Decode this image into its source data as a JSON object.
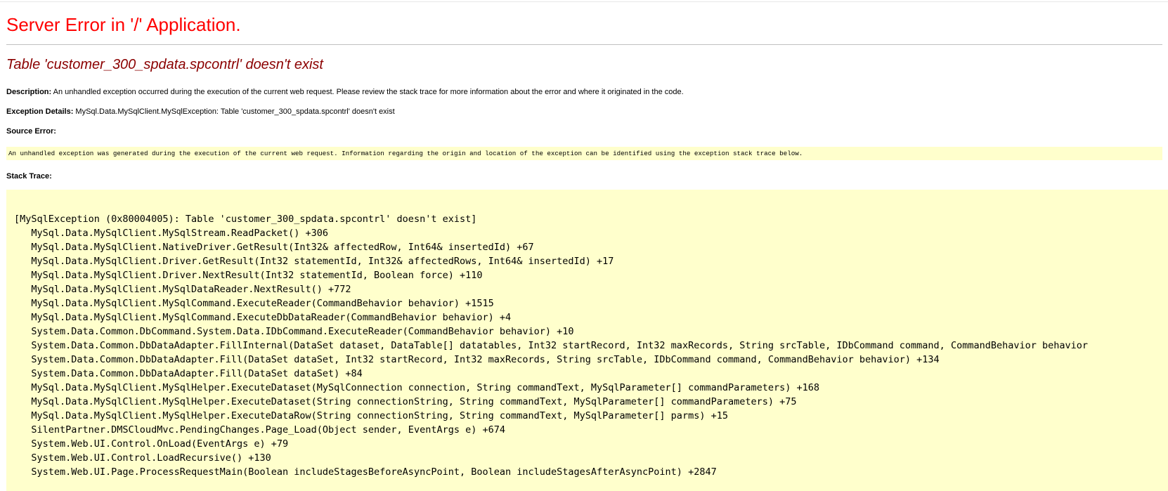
{
  "app_title": "Server Error in '/' Application.",
  "error_heading": "Table 'customer_300_spdata.spcontrl' doesn't exist",
  "description": {
    "label": "Description:",
    "text": " An unhandled exception occurred during the execution of the current web request. Please review the stack trace for more information about the error and where it originated in the code."
  },
  "exception_details": {
    "label": "Exception Details:",
    "text": " MySql.Data.MySqlClient.MySqlException: Table 'customer_300_spdata.spcontrl' doesn't exist"
  },
  "source_error": {
    "label": "Source Error:",
    "text": "An unhandled exception was generated during the execution of the current web request. Information regarding the origin and location of the exception can be identified using the exception stack trace below."
  },
  "stack_trace": {
    "label": "Stack Trace:",
    "lines": [
      "[MySqlException (0x80004005): Table 'customer_300_spdata.spcontrl' doesn't exist]",
      "   MySql.Data.MySqlClient.MySqlStream.ReadPacket() +306",
      "   MySql.Data.MySqlClient.NativeDriver.GetResult(Int32& affectedRow, Int64& insertedId) +67",
      "   MySql.Data.MySqlClient.Driver.GetResult(Int32 statementId, Int32& affectedRows, Int64& insertedId) +17",
      "   MySql.Data.MySqlClient.Driver.NextResult(Int32 statementId, Boolean force) +110",
      "   MySql.Data.MySqlClient.MySqlDataReader.NextResult() +772",
      "   MySql.Data.MySqlClient.MySqlCommand.ExecuteReader(CommandBehavior behavior) +1515",
      "   MySql.Data.MySqlClient.MySqlCommand.ExecuteDbDataReader(CommandBehavior behavior) +4",
      "   System.Data.Common.DbCommand.System.Data.IDbCommand.ExecuteReader(CommandBehavior behavior) +10",
      "   System.Data.Common.DbDataAdapter.FillInternal(DataSet dataset, DataTable[] datatables, Int32 startRecord, Int32 maxRecords, String srcTable, IDbCommand command, CommandBehavior behavior",
      "   System.Data.Common.DbDataAdapter.Fill(DataSet dataSet, Int32 startRecord, Int32 maxRecords, String srcTable, IDbCommand command, CommandBehavior behavior) +134",
      "   System.Data.Common.DbDataAdapter.Fill(DataSet dataSet) +84",
      "   MySql.Data.MySqlClient.MySqlHelper.ExecuteDataset(MySqlConnection connection, String commandText, MySqlParameter[] commandParameters) +168",
      "   MySql.Data.MySqlClient.MySqlHelper.ExecuteDataset(String connectionString, String commandText, MySqlParameter[] commandParameters) +75",
      "   MySql.Data.MySqlClient.MySqlHelper.ExecuteDataRow(String connectionString, String commandText, MySqlParameter[] parms) +15",
      "   SilentPartner.DMSCloudMvc.PendingChanges.Page_Load(Object sender, EventArgs e) +674",
      "   System.Web.UI.Control.OnLoad(EventArgs e) +79",
      "   System.Web.UI.Control.LoadRecursive() +130",
      "   System.Web.UI.Page.ProcessRequestMain(Boolean includeStagesBeforeAsyncPoint, Boolean includeStagesAfterAsyncPoint) +2847"
    ]
  },
  "colors": {
    "app_title": "#ff0000",
    "error_heading": "#8b0000",
    "code_background": "#ffffcc"
  }
}
